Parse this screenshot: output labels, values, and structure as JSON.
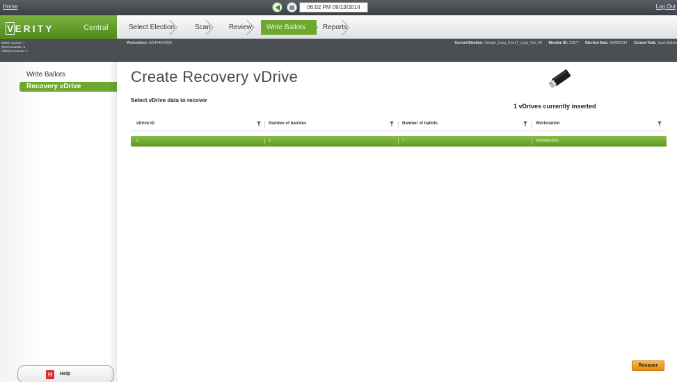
{
  "topbar": {
    "home_link": "Home",
    "logout_link": "Log Out",
    "clock_text": "06:02 PM 09/13/2014"
  },
  "brand": {
    "logo_text": "VERITY",
    "subtitle": "Central"
  },
  "workflow": {
    "steps": [
      {
        "label": "Select Election"
      },
      {
        "label": "Scan"
      },
      {
        "label": "Review"
      },
      {
        "label": "Write Ballots"
      },
      {
        "label": "Reports"
      }
    ],
    "active": "Write Ballots"
  },
  "info": {
    "counters": [
      "Ballot Counter: 7",
      "Sheet Counter: 9",
      "Lifetime Counter: 7"
    ],
    "workstation_label": "Workstation:",
    "workstation_value": "WS494024503",
    "current_election_label": "Current Election:",
    "current_election_value": "Sample_Long_8.5x17_Long_Test_05",
    "election_id_label": "Election ID:",
    "election_id_value": "21977",
    "election_date_label": "Election Date:",
    "election_date_value": "09/08/2014",
    "current_task_label": "Current Task:",
    "current_task_value": "Scan Ballots"
  },
  "sidebar": {
    "items": [
      {
        "label": "Write Ballots"
      },
      {
        "label": "Recovery vDrive"
      }
    ],
    "help_label": "Help",
    "help_icon_letter": "H"
  },
  "main": {
    "title": "Create Recovery vDrive",
    "subtitle": "Select vDrive data to recover",
    "vdrive_count_text": "1 vDrives currently inserted",
    "recover_button": "Recover"
  },
  "table": {
    "columns": [
      "vDrive ID",
      "Number of batches",
      "Number of ballots",
      "Workstation"
    ],
    "rows": [
      [
        "6",
        "2",
        "7",
        "WS494024503"
      ]
    ]
  },
  "colors": {
    "accent_green": "#6ea82e",
    "row_green": "#72ab33",
    "recover_orange": "#f0a22c",
    "help_red": "#d9302c"
  }
}
